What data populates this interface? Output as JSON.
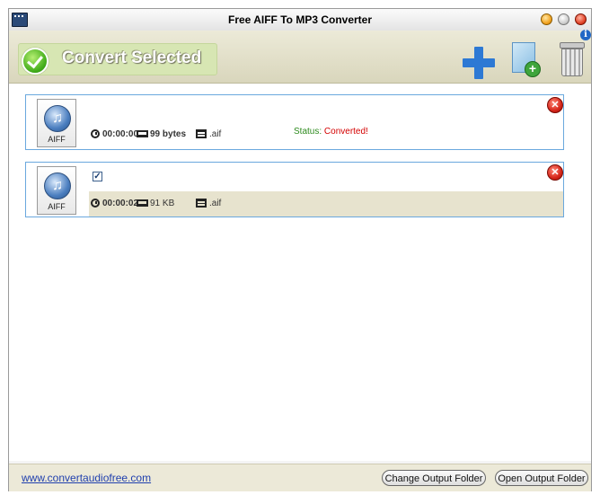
{
  "window": {
    "title": "Free AIFF To MP3 Converter"
  },
  "toolbar": {
    "convert_label": "Convert Selected"
  },
  "files": [
    {
      "ext_badge": "AIFF",
      "duration": "00:00:00",
      "size": "99 bytes",
      "type": ".aif",
      "status_label": "Status: ",
      "status_value": "Converted!",
      "remove_glyph": "✕"
    },
    {
      "ext_badge": "AIFF",
      "checked": true,
      "duration": "00:00:02",
      "size": "91 KB",
      "type": ".aif",
      "remove_glyph": "✕"
    }
  ],
  "footer": {
    "link": "www.convertaudiofree.com",
    "change_output": "Change Output Folder",
    "open_output": "Open Output Folder"
  },
  "icons": {
    "app": "app-icon",
    "convert": "check-circle-icon",
    "add": "plus-icon",
    "add_file": "add-file-icon",
    "delete": "trash-icon",
    "info": "info-icon",
    "file": "music-file-icon",
    "duration": "clock-icon",
    "size": "laptop-icon",
    "format": "film-icon",
    "remove": "remove-icon"
  },
  "colors": {
    "status_label": "#2e8b1f",
    "status_value": "#d40000",
    "accent_blue": "#2d79d4",
    "item_border": "#6aa8de"
  }
}
